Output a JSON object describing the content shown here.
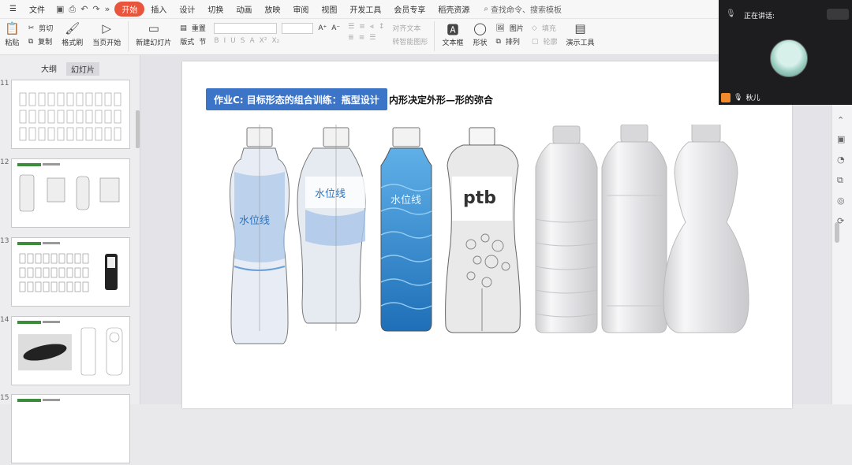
{
  "menubar": {
    "file": "文件",
    "items": [
      "开始",
      "插入",
      "设计",
      "切换",
      "动画",
      "放映",
      "审阅",
      "视图",
      "开发工具",
      "会员专享",
      "稻壳资源"
    ],
    "active_index": 0,
    "search": "查找命令、搜索模板"
  },
  "ribbon": {
    "paste": "粘贴",
    "cut": "剪切",
    "copy": "复制",
    "format_painter": "格式刷",
    "from_current": "当页开始",
    "new_slide": "新建幻灯片",
    "layout": "版式",
    "section": "节",
    "reset": "重置",
    "align_text": "对齐文本",
    "smartart": "转智能图形",
    "textbox": "文本框",
    "shape": "形状",
    "arrange": "排列",
    "picture": "图片",
    "fill": "填充",
    "outline": "轮廓",
    "present_tools": "演示工具"
  },
  "left_panel": {
    "tab_outline": "大纲",
    "tab_slides": "幻灯片",
    "slides": [
      {
        "num": "11"
      },
      {
        "num": "12"
      },
      {
        "num": "13"
      },
      {
        "num": "14"
      },
      {
        "num": "15"
      }
    ]
  },
  "slide": {
    "title": "作业C: 目标形态的组合训练：瓶型设计",
    "subtitle": "内形决定外形—形的弥合",
    "bottle_labels": [
      "水位线",
      "水位线",
      "水位线",
      "ptb"
    ]
  },
  "video": {
    "speaking": "正在讲话:",
    "name": "秋儿"
  },
  "colors": {
    "accent": "#e8543c",
    "title_blue": "#3c74c8",
    "bottle_blue": "#3a8fd8"
  }
}
